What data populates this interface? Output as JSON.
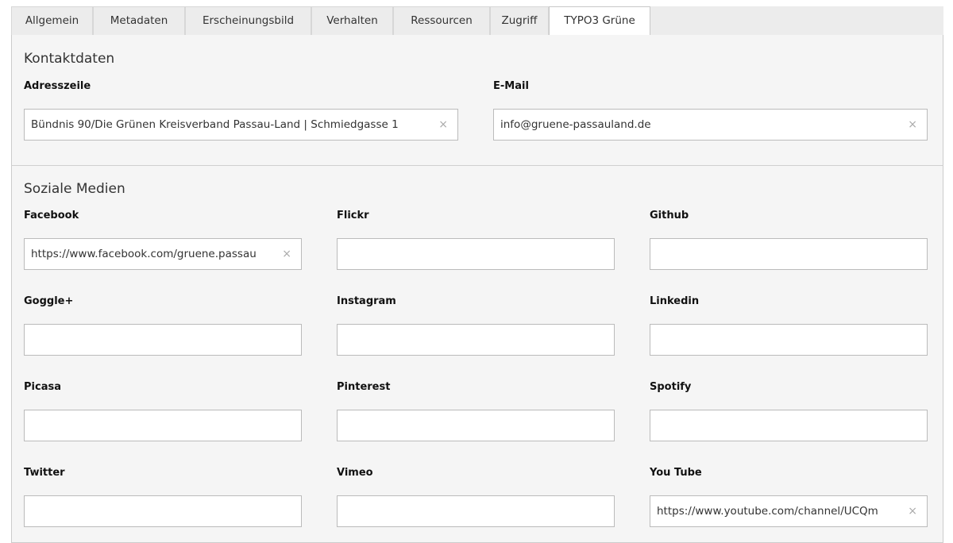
{
  "tabs": [
    {
      "label": "Allgemein"
    },
    {
      "label": "Metadaten"
    },
    {
      "label": "Erscheinungsbild"
    },
    {
      "label": "Verhalten"
    },
    {
      "label": "Ressourcen"
    },
    {
      "label": "Zugriff"
    },
    {
      "label": "TYPO3 Grüne",
      "active": true
    }
  ],
  "contact": {
    "title": "Kontaktdaten",
    "address_label": "Adresszeile",
    "address_value": "Bündnis 90/Die Grünen Kreisverband Passau-Land | Schmiedgasse 1",
    "email_label": "E-Mail",
    "email_value": "info@gruene-passauland.de"
  },
  "social": {
    "title": "Soziale Medien",
    "fields": [
      {
        "label": "Facebook",
        "value": "https://www.facebook.com/gruene.passau"
      },
      {
        "label": "Flickr",
        "value": ""
      },
      {
        "label": "Github",
        "value": ""
      },
      {
        "label": "Goggle+",
        "value": ""
      },
      {
        "label": "Instagram",
        "value": ""
      },
      {
        "label": "Linkedin",
        "value": ""
      },
      {
        "label": "Picasa",
        "value": ""
      },
      {
        "label": "Pinterest",
        "value": ""
      },
      {
        "label": "Spotify",
        "value": ""
      },
      {
        "label": "Twitter",
        "value": ""
      },
      {
        "label": "Vimeo",
        "value": ""
      },
      {
        "label": "You Tube",
        "value": "https://www.youtube.com/channel/UCQm"
      }
    ]
  },
  "clear_glyph": "×",
  "icons": {
    "clear": "close-icon"
  }
}
